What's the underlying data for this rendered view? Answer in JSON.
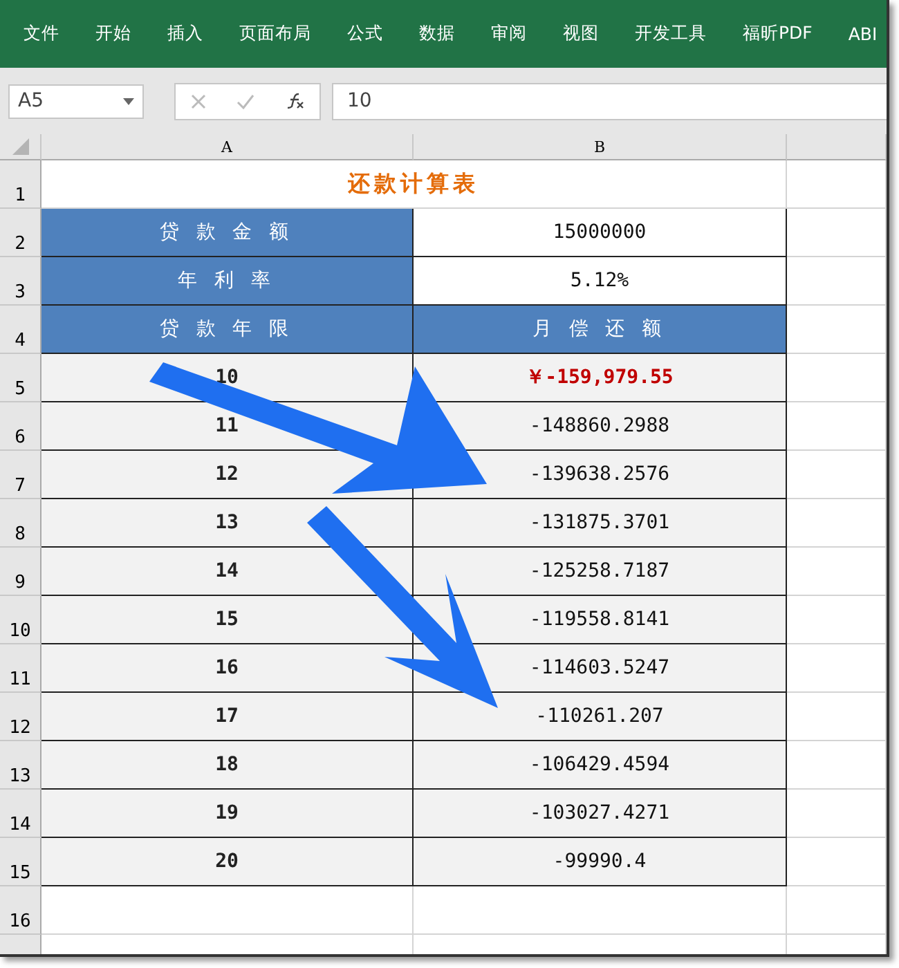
{
  "ribbon_tabs": [
    "文件",
    "开始",
    "插入",
    "页面布局",
    "公式",
    "数据",
    "审阅",
    "视图",
    "开发工具",
    "福昕PDF",
    "ABI"
  ],
  "formula_bar": {
    "name_box": "A5",
    "formula": "10"
  },
  "column_headers": [
    "A",
    "B"
  ],
  "row_numbers": [
    "1",
    "2",
    "3",
    "4",
    "5",
    "6",
    "7",
    "8",
    "9",
    "10",
    "11",
    "12",
    "13",
    "14",
    "15",
    "16"
  ],
  "sheet": {
    "title": "还款计算表",
    "inputs": [
      {
        "label": "贷 款 金 额",
        "value": "15000000"
      },
      {
        "label": "年  利  率",
        "value": "5.12%"
      }
    ],
    "header": [
      "贷 款 年 限",
      "月 偿 还 额"
    ],
    "rows": [
      {
        "years": "10",
        "payment": "￥-159,979.55",
        "kind": "currency"
      },
      {
        "years": "11",
        "payment": "-148860.2988",
        "kind": "plain"
      },
      {
        "years": "12",
        "payment": "-139638.2576",
        "kind": "plain"
      },
      {
        "years": "13",
        "payment": "-131875.3701",
        "kind": "plain"
      },
      {
        "years": "14",
        "payment": "-125258.7187",
        "kind": "plain"
      },
      {
        "years": "15",
        "payment": "-119558.8141",
        "kind": "plain"
      },
      {
        "years": "16",
        "payment": "-114603.5247",
        "kind": "plain"
      },
      {
        "years": "17",
        "payment": "-110261.207",
        "kind": "plain"
      },
      {
        "years": "18",
        "payment": "-106429.4594",
        "kind": "plain"
      },
      {
        "years": "19",
        "payment": "-103027.4271",
        "kind": "plain"
      },
      {
        "years": "20",
        "payment": "-99990.4",
        "kind": "plain"
      }
    ]
  }
}
